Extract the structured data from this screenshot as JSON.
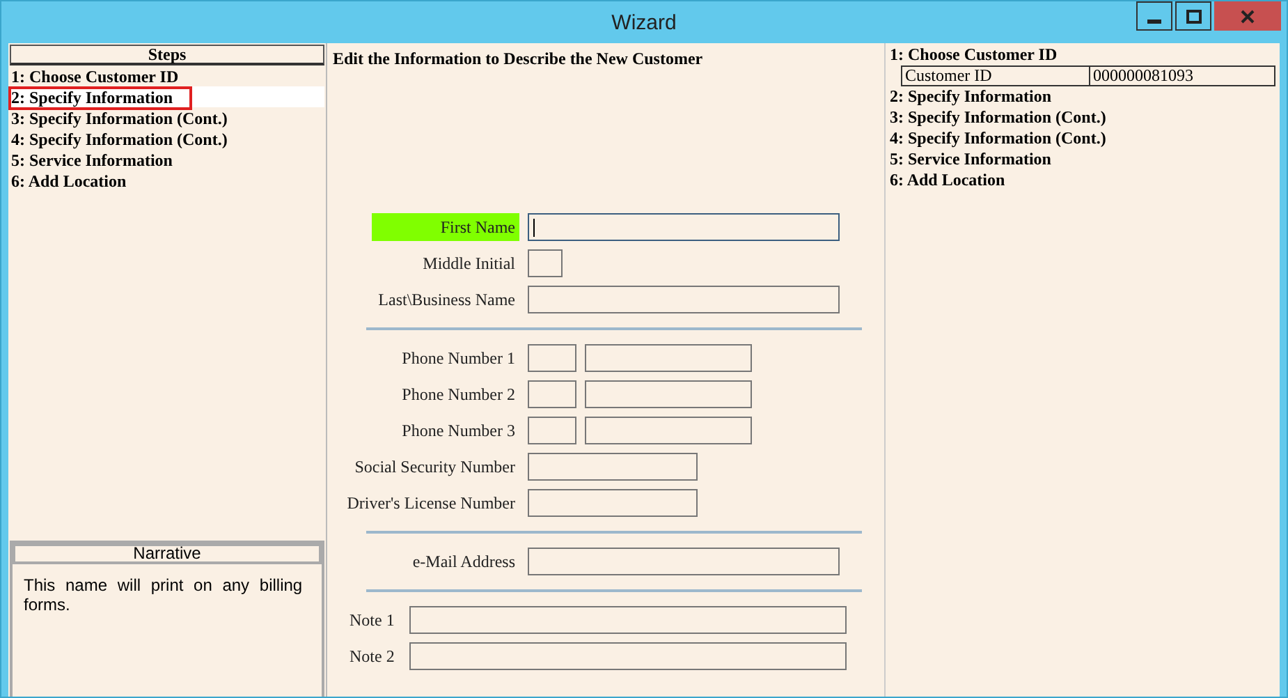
{
  "window": {
    "title": "Wizard"
  },
  "steps": {
    "title": "Steps",
    "items": [
      {
        "label": "1: Choose Customer ID",
        "selected": false
      },
      {
        "label": "2: Specify Information",
        "selected": true
      },
      {
        "label": "3: Specify Information (Cont.)",
        "selected": false
      },
      {
        "label": "4: Specify Information (Cont.)",
        "selected": false
      },
      {
        "label": "5: Service Information",
        "selected": false
      },
      {
        "label": "6: Add Location",
        "selected": false
      }
    ]
  },
  "narrative": {
    "title": "Narrative",
    "text": "This name will print on any billing forms."
  },
  "form": {
    "heading": "Edit the Information to Describe the New Customer",
    "groups": [
      [
        {
          "label": "First Name",
          "kind": "long",
          "highlighted": true,
          "focused": true
        },
        {
          "label": "Middle Initial",
          "kind": "initial",
          "highlighted": false,
          "focused": false
        },
        {
          "label": "Last\\Business Name",
          "kind": "long",
          "highlighted": false,
          "focused": false
        }
      ],
      [
        {
          "label": "Phone Number 1",
          "kind": "phone",
          "highlighted": false,
          "focused": false
        },
        {
          "label": "Phone Number 2",
          "kind": "phone",
          "highlighted": false,
          "focused": false
        },
        {
          "label": "Phone Number 3",
          "kind": "phone",
          "highlighted": false,
          "focused": false
        },
        {
          "label": "Social Security Number",
          "kind": "medium",
          "highlighted": false,
          "focused": false
        },
        {
          "label": "Driver's License Number",
          "kind": "medium",
          "highlighted": false,
          "focused": false
        }
      ],
      [
        {
          "label": "e-Mail Address",
          "kind": "long",
          "highlighted": false,
          "focused": false
        }
      ],
      [
        {
          "label": "Note 1",
          "kind": "note",
          "highlighted": false,
          "focused": false
        },
        {
          "label": "Note 2",
          "kind": "note",
          "highlighted": false,
          "focused": false
        }
      ]
    ]
  },
  "summary": {
    "items": [
      {
        "label": "1: Choose Customer ID",
        "rows": [
          {
            "name": "Customer ID",
            "value": "000000081093"
          }
        ]
      },
      {
        "label": "2: Specify Information"
      },
      {
        "label": "3: Specify Information (Cont.)"
      },
      {
        "label": "4: Specify Information (Cont.)"
      },
      {
        "label": "5: Service Information"
      },
      {
        "label": "6: Add Location"
      }
    ]
  }
}
